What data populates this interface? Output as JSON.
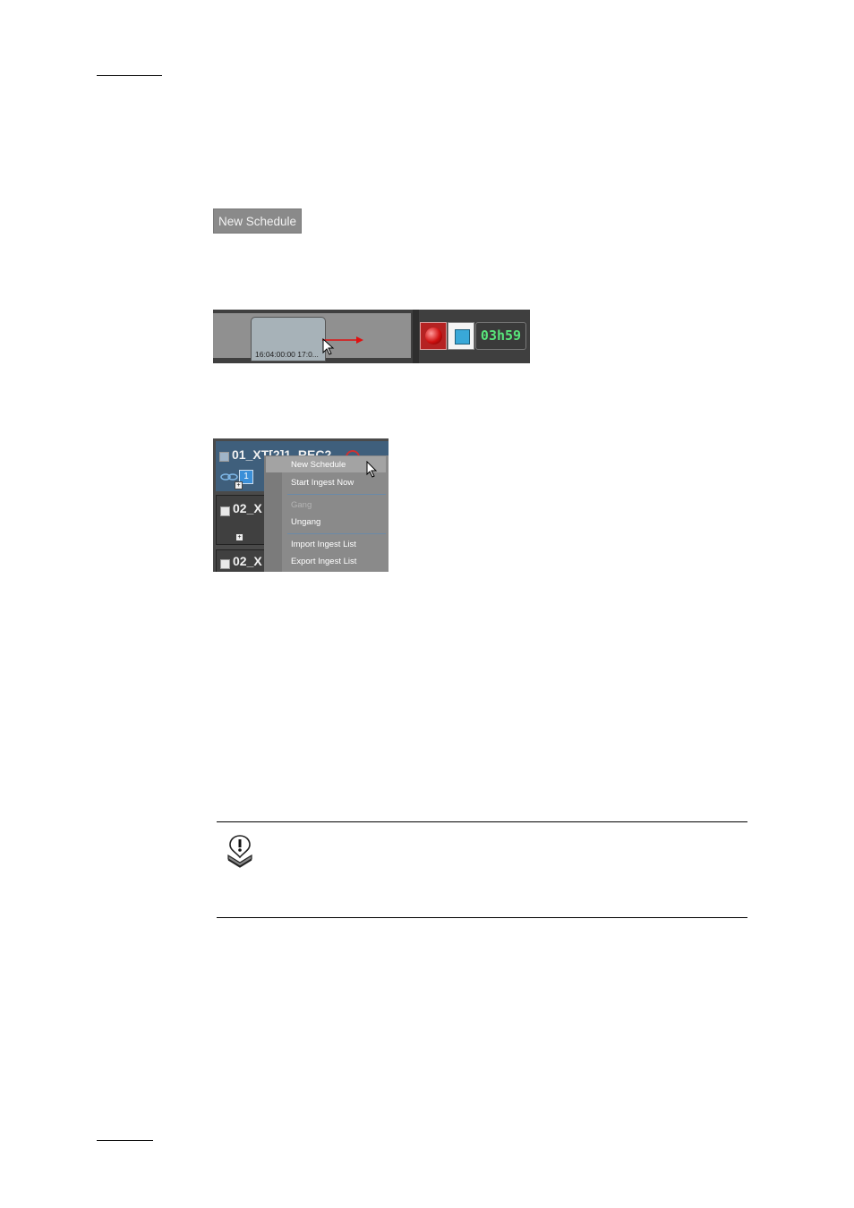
{
  "new_schedule_button": {
    "label": "New Schedule"
  },
  "timeline": {
    "block_text": "16:04:00:00 17:0...",
    "timer": "03h59"
  },
  "context_menu": {
    "rows": [
      {
        "title": "01_XT[2]1_REC2",
        "badge": "1"
      },
      {
        "title": "02_X"
      },
      {
        "title": "02_X"
      }
    ],
    "items": [
      {
        "label": "New Schedule",
        "enabled": true
      },
      {
        "label": "Start Ingest Now",
        "enabled": true
      },
      {
        "label": "Gang",
        "enabled": false
      },
      {
        "label": "Ungang",
        "enabled": true
      },
      {
        "label": "Import Ingest List",
        "enabled": true
      },
      {
        "label": "Export Ingest List",
        "enabled": true
      }
    ]
  },
  "note": {
    "icon": "note-icon"
  }
}
